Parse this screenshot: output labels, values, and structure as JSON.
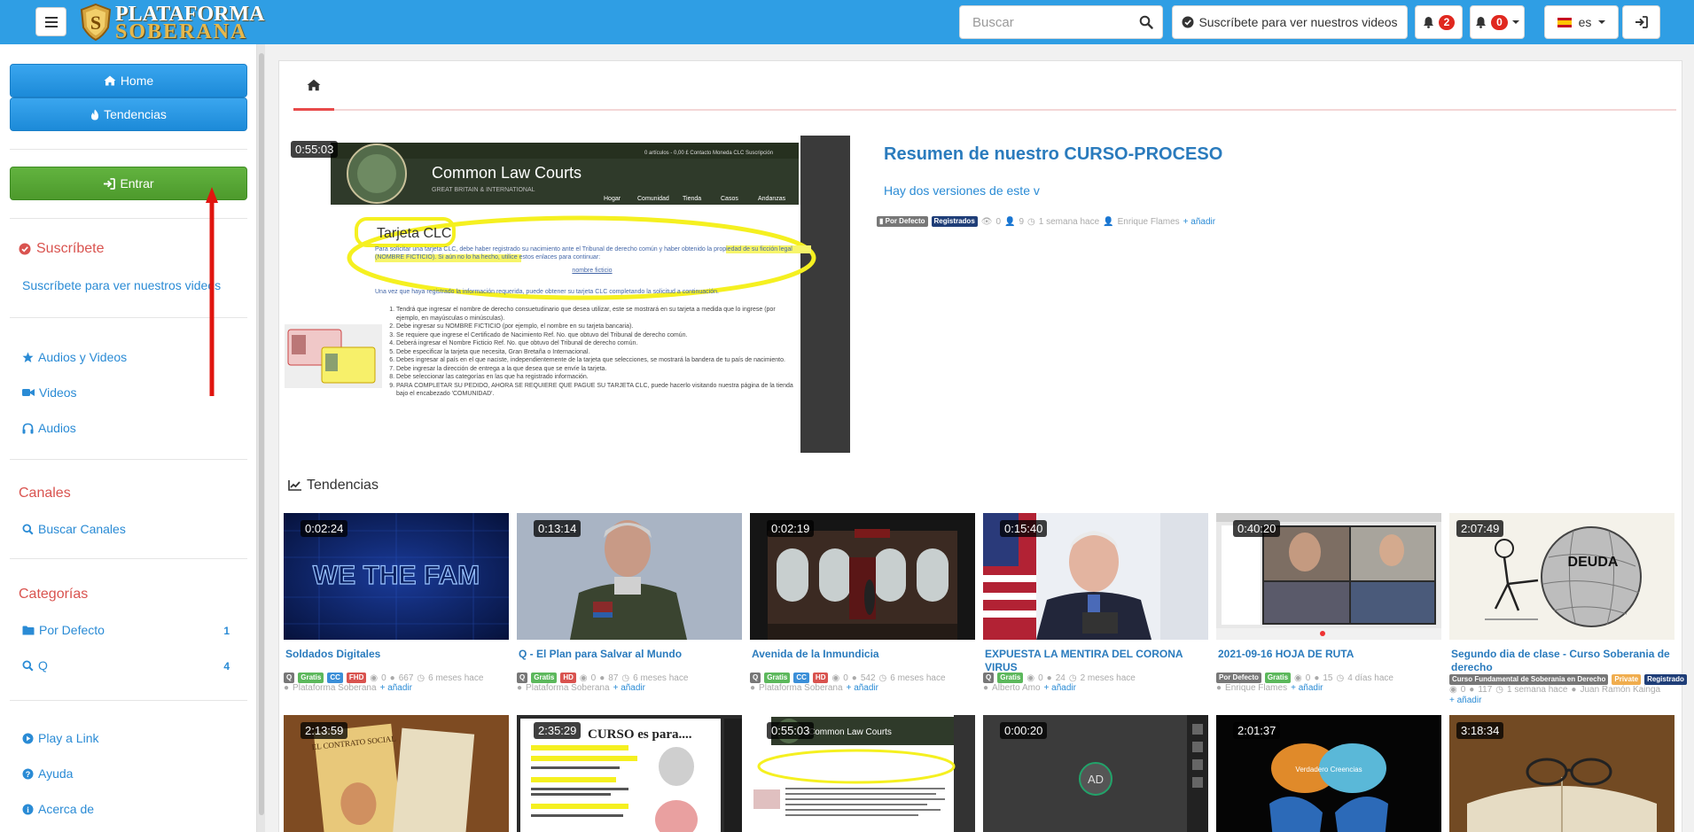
{
  "header": {
    "logo_line1": "PLATAFORMA",
    "logo_line2": "SOBERANA",
    "search_placeholder": "Buscar",
    "subscribe_label": "Suscríbete para ver nuestros videos",
    "notif_count_1": "2",
    "notif_count_2": "0",
    "language": "es",
    "icons": [
      "menu-icon",
      "search-icon",
      "check-circle-icon",
      "bell-icon",
      "bell-icon",
      "flag-spain-icon",
      "sign-in-icon"
    ]
  },
  "sidebar": {
    "home_label": "Home",
    "trending_label": "Tendencias",
    "login_label": "Entrar",
    "subscribe_heading": "Suscríbete",
    "subscribe_link": "Suscríbete para ver nuestros videos",
    "media_items": [
      {
        "label": "Audios y Videos",
        "icon": "star-icon"
      },
      {
        "label": "Videos",
        "icon": "video-camera-icon"
      },
      {
        "label": "Audios",
        "icon": "headphones-icon"
      }
    ],
    "channels_heading": "Canales",
    "search_channels": "Buscar Canales",
    "categories_heading": "Categorías",
    "categories": [
      {
        "label": "Por Defecto",
        "count": "1"
      },
      {
        "label": "Q",
        "count": "4"
      }
    ],
    "footer_items": [
      {
        "label": "Play a Link",
        "icon": "play-circle-icon"
      },
      {
        "label": "Ayuda",
        "icon": "question-circle-icon"
      },
      {
        "label": "Acerca de",
        "icon": "info-circle-icon"
      }
    ]
  },
  "featured": {
    "duration": "0:55:03",
    "title": "Resumen de nuestro CURSO-PROCESO",
    "description": "Hay dos versiones de este v",
    "tags": [
      "Por Defecto",
      "Registrados"
    ],
    "likes": "0",
    "views": "9",
    "time": "1 semana hace",
    "author": "Enrique Flames",
    "add": "añadir",
    "thumbnail": {
      "site_name": "Common Law Courts",
      "site_sub": "GREAT BRITAIN & INTERNATIONAL",
      "top_links": "0 artículos - 0,00 £    Contacto   Moneda CLC   Suscripción",
      "nav": [
        "Hogar",
        "Comunidad",
        "Tienda",
        "Casos",
        "Andanzas"
      ],
      "heading": "Tarjeta CLC",
      "para1": "Para solicitar una tarjeta CLC, debe haber registrado su nacimiento ante el Tribunal de derecho común y haber obtenido la propiedad de su ficción legal (NOMBRE FICTICIO). Si aún no lo ha hecho, utilice estos enlaces para continuar:",
      "link": "nombre ficticio",
      "para2": "Una vez que haya registrado la información requerida, puede obtener su tarjeta CLC completando la solicitud a continuación.",
      "steps": [
        "Tendrá que ingresar el nombre de derecho consuetudinario que desea utilizar, este se mostrará en su tarjeta a medida que lo ingrese (por ejemplo, en mayúsculas o minúsculas).",
        "Debe ingresar su NOMBRE FICTICIO (por ejemplo, el nombre en su tarjeta bancaria).",
        "Se requiere que ingrese el Certificado de Nacimiento Ref. No. que obtuvo del Tribunal de derecho común.",
        "Deberá ingresar el Nombre Ficticio Ref. No. que obtuvo del Tribunal de derecho común.",
        "Debe especificar la tarjeta que necesita, Gran Bretaña o Internacional.",
        "Debes ingresar al país en el que naciste, independientemente de la tarjeta que selecciones, se mostrará la bandera de tu país de nacimiento.",
        "Debe ingresar la dirección de entrega a la que desea que se envíe la tarjeta.",
        "Debe seleccionar las categorías en las que ha registrado información.",
        "PARA COMPLETAR SU PEDIDO, AHORA SE REQUIERE QUE PAGUE SU TARJETA CLC, puede hacerlo visitando nuestra página de la tienda bajo el encabezado 'COMUNIDAD'."
      ]
    }
  },
  "trending_heading": "Tendencias",
  "videos_row1": [
    {
      "duration": "0:02:24",
      "title": "Soldados Digitales",
      "tags": [
        "Q",
        "Gratis",
        "CC",
        "FHD"
      ],
      "likes": "0",
      "views": "667",
      "time": "6 meses hace",
      "author": "Plataforma Soberana",
      "add": "añadir",
      "thumb_text": "WE THE FAM"
    },
    {
      "duration": "0:13:14",
      "title": "Q - El Plan para Salvar al Mundo",
      "tags": [
        "Q",
        "Gratis",
        "HD"
      ],
      "likes": "0",
      "views": "87",
      "time": "6 meses hace",
      "author": "Plataforma Soberana",
      "add": "añadir"
    },
    {
      "duration": "0:02:19",
      "title": "Avenida de la Inmundicia",
      "tags": [
        "Q",
        "Gratis",
        "CC",
        "HD"
      ],
      "likes": "0",
      "views": "542",
      "time": "6 meses hace",
      "author": "Plataforma Soberana",
      "add": "añadir"
    },
    {
      "duration": "0:15:40",
      "title": "EXPUESTA LA MENTIRA DEL CORONA VIRUS",
      "tags": [
        "Q",
        "Gratis"
      ],
      "likes": "0",
      "views": "24",
      "time": "2 meses hace",
      "author": "Alberto Amo",
      "add": "añadir"
    },
    {
      "duration": "0:40:20",
      "title": "2021-09-16 HOJA DE RUTA",
      "tags": [
        "Por Defecto",
        "Gratis"
      ],
      "likes": "0",
      "views": "15",
      "time": "4 días hace",
      "author": "Enrique Flames",
      "add": "añadir"
    },
    {
      "duration": "2:07:49",
      "title": "Segundo dia de clase - Curso Soberania de derecho",
      "tags": [
        "Curso Fundamental de Soberania en Derecho",
        "Private",
        "Registrado"
      ],
      "likes": "0",
      "views": "117",
      "time": "1 semana hace",
      "author": "Juan Ramón Kainga",
      "add": "añadir",
      "thumb_text": "DEUDA"
    }
  ],
  "videos_row2": [
    {
      "duration": "2:13:59",
      "thumb_text": "EL CONTRATO SOCIAL"
    },
    {
      "duration": "2:35:29",
      "thumb_text": "CURSO es para...."
    },
    {
      "duration": "0:55:03",
      "thumb_text": "Common Law Courts"
    },
    {
      "duration": "0:00:20",
      "thumb_text": "AD"
    },
    {
      "duration": "2:01:37",
      "thumb_text": "Verdadero  Creencias"
    },
    {
      "duration": "3:18:34",
      "thumb_text": ""
    }
  ],
  "colors": {
    "topbar": "#2f9ee4",
    "link": "#2a8bd5",
    "heading_red": "#d9534f",
    "green_button": "#5cb85c",
    "annotation_arrow": "#e0150f",
    "highlight": "#f5f020"
  }
}
